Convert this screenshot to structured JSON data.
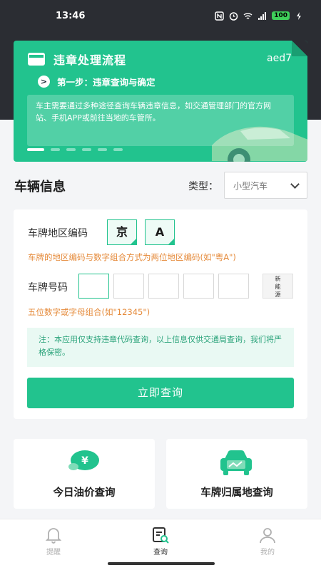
{
  "status_bar": {
    "time": "13:46",
    "battery": "100"
  },
  "banner": {
    "title": "违章处理流程",
    "code": "aed7",
    "step_icon": ">",
    "step_text": "第一步：违章查询与确定",
    "description": "车主需要通过多种途径查询车辆违章信息，如交通管理部门的官方网站、手机APP或前往当地的车管所。",
    "accent": "#22c38e"
  },
  "vehicle_info": {
    "title": "车辆信息",
    "type_label": "类型：",
    "type_value": "小型汽车"
  },
  "form": {
    "region_label": "车牌地区编码",
    "region_province": "京",
    "region_letter": "A",
    "region_hint": "车牌的地区编码与数字组合方式为两位地区编码(如\"粤A\")",
    "plate_label": "车牌号码",
    "new_energy": [
      "新",
      "能",
      "源"
    ],
    "plate_hint": "五位数字或字母组合(如\"12345\")",
    "note": "注：本应用仅支持违章代码查询，以上信息仅供交通局查询，我们将严格保密。",
    "query_button": "立即查询"
  },
  "quick_actions": {
    "oil_price": "今日油价查询",
    "oil_icon_char": "¥",
    "plate_location": "车牌归属地查询"
  },
  "tabbar": {
    "remind": "提醒",
    "query": "查询",
    "mine": "我的"
  }
}
